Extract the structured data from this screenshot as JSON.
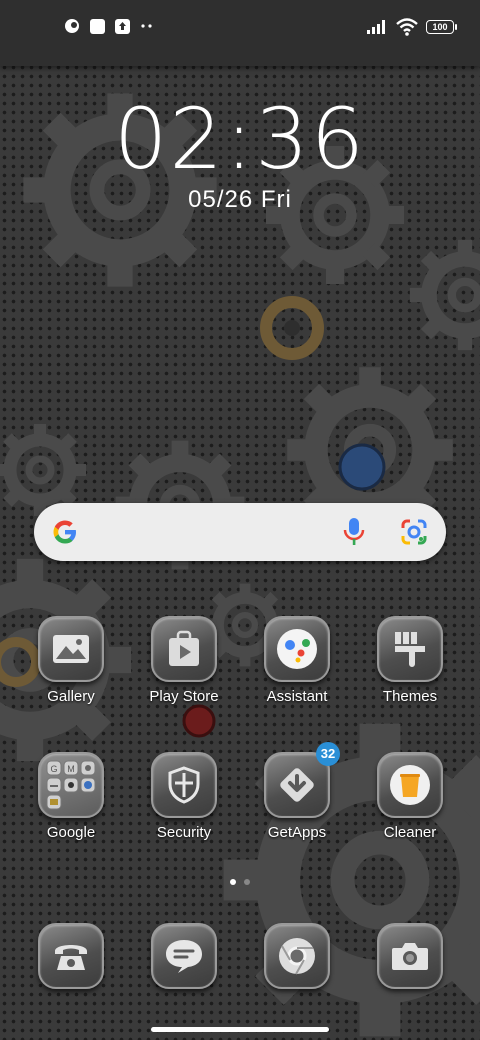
{
  "status_bar": {
    "icons": [
      "app-notification-icon",
      "square-notification-icon",
      "upload-icon",
      "more-dots-icon"
    ],
    "signal": "signal-bars-icon",
    "wifi": "wifi-icon",
    "battery": "100"
  },
  "lock": {
    "time": "02:36",
    "date": "05/26 Fri"
  },
  "search": {
    "google_icon": "google-g-icon",
    "mic_icon": "mic-icon",
    "lens_icon": "lens-icon"
  },
  "apps_row1": [
    {
      "label": "Gallery",
      "icon": "gallery-icon"
    },
    {
      "label": "Play Store",
      "icon": "play-store-icon"
    },
    {
      "label": "Assistant",
      "icon": "assistant-icon"
    },
    {
      "label": "Themes",
      "icon": "themes-icon"
    }
  ],
  "apps_row2": [
    {
      "label": "Google",
      "icon": "google-folder-icon"
    },
    {
      "label": "Security",
      "icon": "security-icon"
    },
    {
      "label": "GetApps",
      "icon": "getapps-icon",
      "badge": "32"
    },
    {
      "label": "Cleaner",
      "icon": "cleaner-icon"
    }
  ],
  "dock": [
    {
      "icon": "phone-icon"
    },
    {
      "icon": "messages-icon"
    },
    {
      "icon": "chrome-icon"
    },
    {
      "icon": "camera-icon"
    }
  ],
  "page_indicator": {
    "pages": 2,
    "current": 1
  },
  "colors": {
    "badge": "#2a8fd6",
    "search_bg": "#ededed",
    "wallpaper": "#3a3a3a"
  }
}
